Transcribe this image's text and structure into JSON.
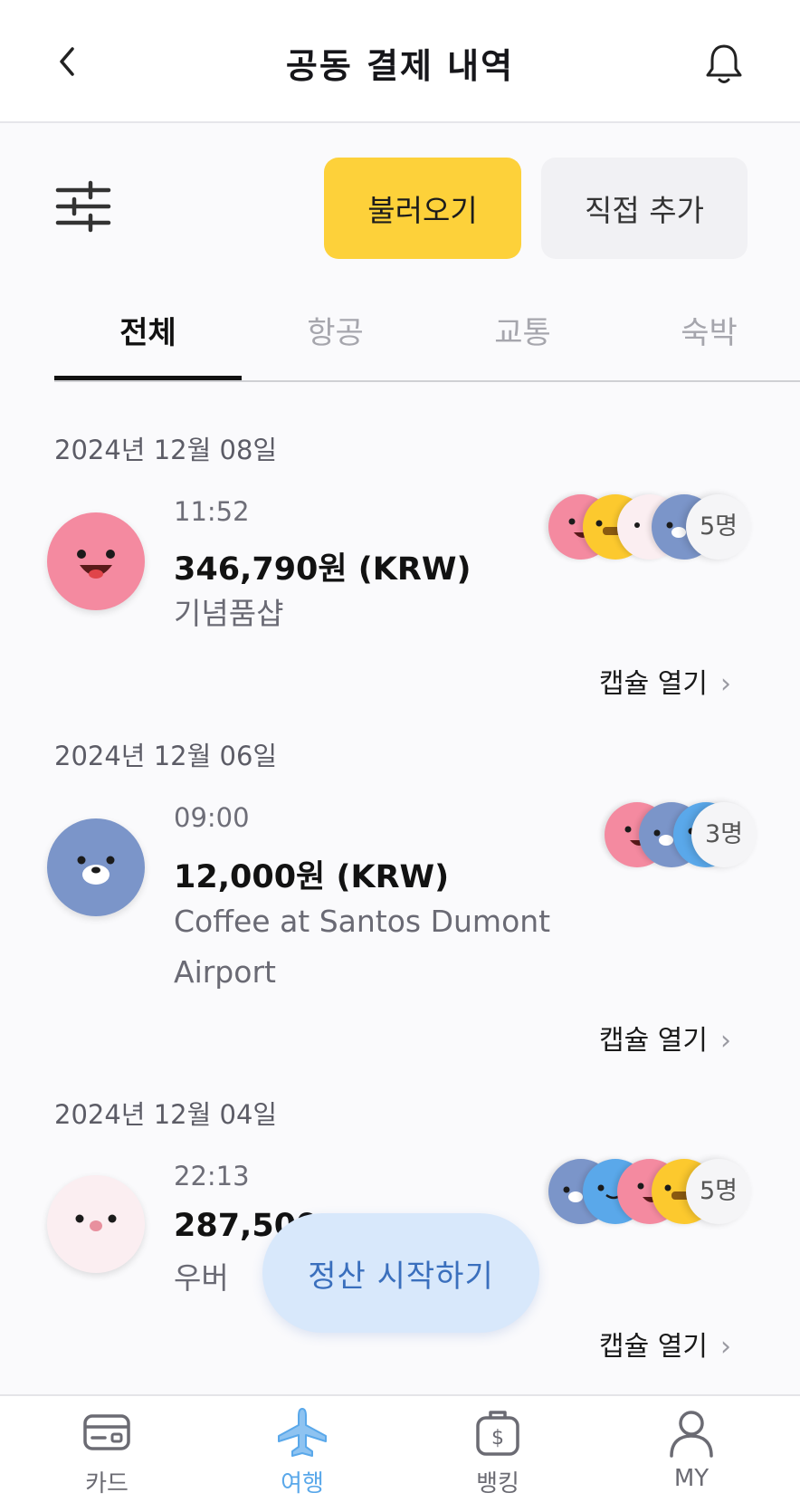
{
  "header": {
    "title": "공동 결제 내역"
  },
  "actions": {
    "import_label": "불러오기",
    "add_label": "직접 추가"
  },
  "tabs": [
    {
      "label": "전체",
      "active": true
    },
    {
      "label": "항공",
      "active": false
    },
    {
      "label": "교통",
      "active": false
    },
    {
      "label": "숙박",
      "active": false
    }
  ],
  "transactions": [
    {
      "date": "2024년 12월 08일",
      "time": "11:52",
      "amount": "346,790원 (KRW)",
      "merchant": "기념품샵",
      "avatar": "pink-face",
      "members": [
        "pink",
        "yellow",
        "white",
        "blue"
      ],
      "member_count": "5명",
      "capsule_label": "캡슐 열기"
    },
    {
      "date": "2024년 12월 06일",
      "time": "09:00",
      "amount": "12,000원 (KRW)",
      "merchant": "Coffee at Santos Dumont Airport",
      "avatar": "blue-bear",
      "members": [
        "pink",
        "blue",
        "sky"
      ],
      "member_count": "3명",
      "capsule_label": "캡슐 열기"
    },
    {
      "date": "2024년 12월 04일",
      "time": "22:13",
      "amount": "287,500",
      "merchant": "우버",
      "avatar": "white-face",
      "members": [
        "blue",
        "sky",
        "pink",
        "yellow"
      ],
      "member_count": "5명",
      "capsule_label": "캡슐 열기"
    }
  ],
  "settle_button": "정산 시작하기",
  "bottom_nav": [
    {
      "label": "카드",
      "icon": "card-icon",
      "active": false
    },
    {
      "label": "여행",
      "icon": "airplane-icon",
      "active": true
    },
    {
      "label": "뱅킹",
      "icon": "money-bag-icon",
      "active": false
    },
    {
      "label": "MY",
      "icon": "person-icon",
      "active": false
    }
  ],
  "colors": {
    "accent_yellow": "#fdd13a",
    "accent_blue": "#5aa8ea",
    "settle_bg": "#d8e8fb"
  }
}
